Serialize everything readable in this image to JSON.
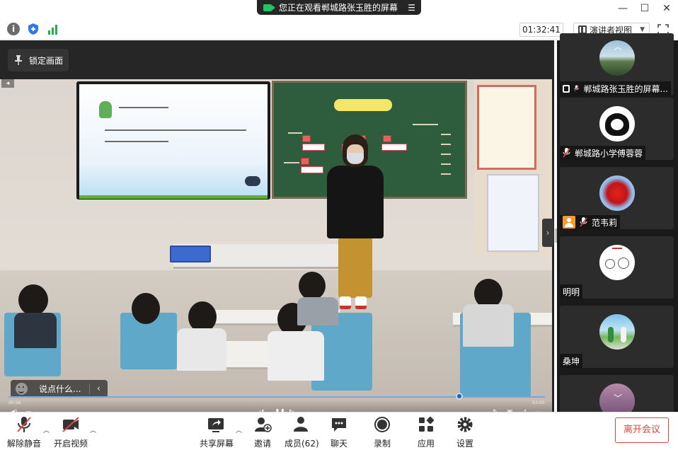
{
  "window": {
    "share_banner": "您正在观看郸城路张玉胜的屏幕",
    "controls": [
      "—",
      "☐",
      "✕"
    ]
  },
  "toolbar": {
    "timer": "01:32:41",
    "view_mode": "演讲者视图"
  },
  "stage": {
    "lock_label": "锁定画面",
    "comment_placeholder": "说点什么...",
    "video_time_left": "00:56",
    "video_time_right": "03:00",
    "video_progress": 0.84
  },
  "participants": [
    {
      "name": "郸城路张玉胜的屏幕...",
      "icon": "share-screen-icon",
      "muted": true
    },
    {
      "name": "郸城路小学傅蓉蓉",
      "icon": "",
      "muted": true
    },
    {
      "name": "范韦莉",
      "icon": "host-icon",
      "muted": true
    },
    {
      "name": "明明",
      "icon": "",
      "muted": false
    },
    {
      "name": "桑坤",
      "icon": "",
      "muted": false
    }
  ],
  "bottom": {
    "mute_label": "解除静音",
    "video_label": "开启视频",
    "share_label": "共享屏幕",
    "invite_label": "邀请",
    "members_label": "成员(62)",
    "chat_label": "聊天",
    "record_label": "录制",
    "apps_label": "应用",
    "settings_label": "设置",
    "leave_label": "离开会议"
  },
  "colors": {
    "leave": "#e0443e",
    "panel_bg": "#1a1a1a",
    "stage_bg": "#262626",
    "share_green": "#22c55e"
  }
}
